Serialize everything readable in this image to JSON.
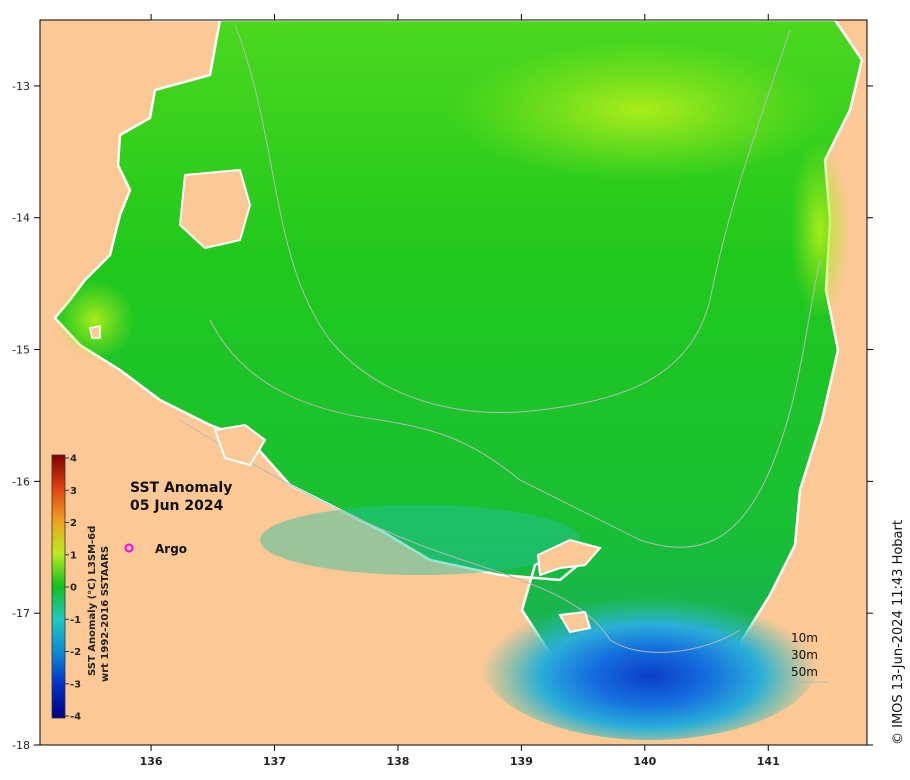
{
  "title": "SST Anomaly",
  "date": "05 Jun 2024",
  "legend": {
    "argo_label": "Argo",
    "argo_color": "#ff00ff"
  },
  "colorbar": {
    "label_line1": "SST Anomaly (°C) L3SM-6d",
    "label_line2": "wrt 1992-2016 SSTAARS",
    "ticks": [
      "-4",
      "-3",
      "-2",
      "-1",
      "0",
      "1",
      "2",
      "3",
      "4"
    ],
    "range": [
      -4,
      4
    ]
  },
  "contours": {
    "labels": [
      "10m",
      "30m",
      "50m"
    ]
  },
  "credit": "© IMOS 13-Jun-2024 11:43 Hobart",
  "colors": {
    "land": "#fcc896",
    "frame": "#000000",
    "contour": "#b8b8b8"
  },
  "axes": {
    "x_ticks": [
      136,
      137,
      138,
      139,
      140,
      141
    ],
    "y_ticks": [
      -13,
      -14,
      -15,
      -16,
      -17,
      -18
    ],
    "xlim": [
      135.1,
      141.8
    ],
    "ylim": [
      -18.0,
      -12.5
    ]
  }
}
